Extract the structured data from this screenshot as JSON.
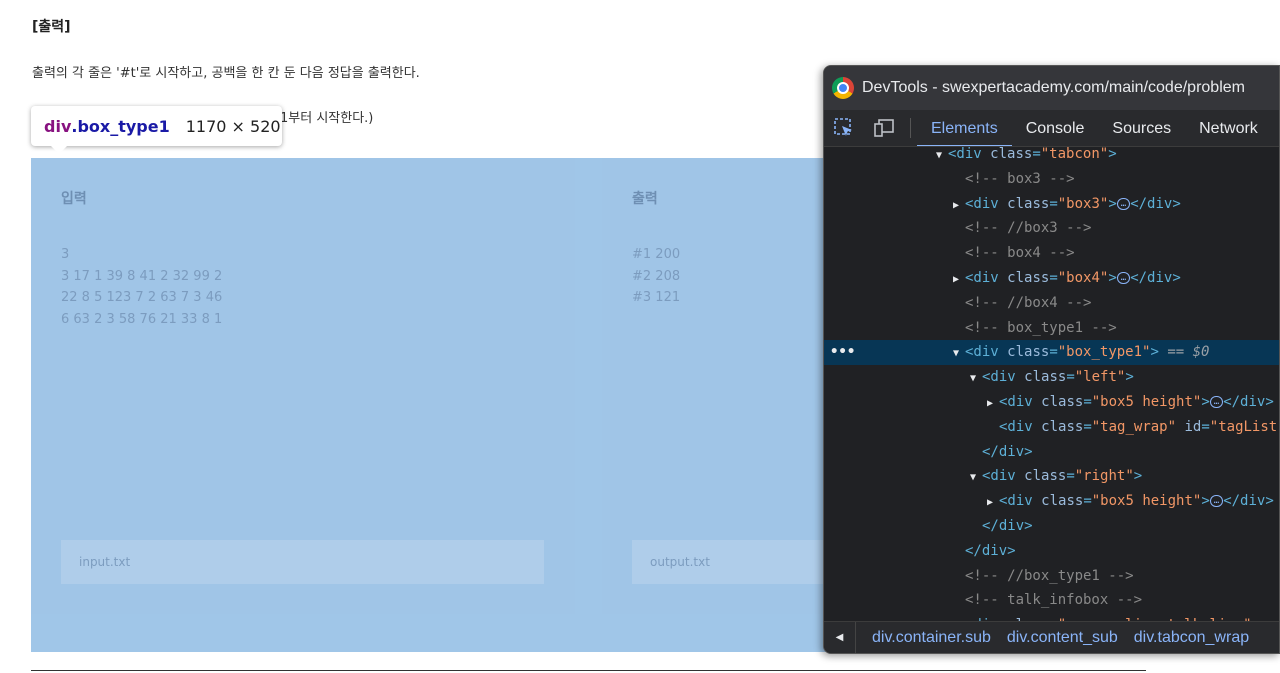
{
  "page": {
    "heading": "[출력]",
    "para1": "출력의 각 줄은 '#t'로 시작하고, 공백을 한 칸 둔 다음 정답을 출력한다.",
    "para2_visible": "1부터 시작한다.)"
  },
  "tooltip": {
    "tag": "div",
    "cls": ".box_type1",
    "size": "1170 × 520"
  },
  "input_panel": {
    "title": "입력",
    "lines": [
      "3",
      "3 17 1 39 8 41 2 32 99 2",
      "22 8 5 123 7 2 63 7 3 46",
      "6 63 2 3 58 76 21 33 8 1"
    ],
    "file": "input.txt"
  },
  "output_panel": {
    "title": "출력",
    "lines": [
      "#1 200",
      "#2 208",
      "#3 121"
    ],
    "file": "output.txt"
  },
  "devtools": {
    "title": "DevTools - swexpertacademy.com/main/code/problem",
    "tabs": [
      "Elements",
      "Console",
      "Sources",
      "Network"
    ],
    "dom": [
      {
        "indent": 1,
        "tri": "▼",
        "html": [
          [
            "tag",
            "<div "
          ],
          [
            "attr",
            "class"
          ],
          [
            "tag",
            "="
          ],
          [
            "val",
            "\"tabcon\""
          ],
          [
            "tag",
            ">"
          ]
        ]
      },
      {
        "indent": 2,
        "tri": "",
        "html": [
          [
            "cmt",
            "<!-- box3 -->"
          ]
        ]
      },
      {
        "indent": 2,
        "tri": "▶",
        "html": [
          [
            "tag",
            "<div "
          ],
          [
            "attr",
            "class"
          ],
          [
            "tag",
            "="
          ],
          [
            "val",
            "\"box3\""
          ],
          [
            "tag",
            ">"
          ],
          [
            "ell",
            "…"
          ],
          [
            "tag",
            "</div>"
          ]
        ]
      },
      {
        "indent": 2,
        "tri": "",
        "html": [
          [
            "cmt",
            "<!-- //box3 -->"
          ]
        ]
      },
      {
        "indent": 2,
        "tri": "",
        "html": [
          [
            "cmt",
            "<!-- box4 -->"
          ]
        ]
      },
      {
        "indent": 2,
        "tri": "▶",
        "html": [
          [
            "tag",
            "<div "
          ],
          [
            "attr",
            "class"
          ],
          [
            "tag",
            "="
          ],
          [
            "val",
            "\"box4\""
          ],
          [
            "tag",
            ">"
          ],
          [
            "ell",
            "…"
          ],
          [
            "tag",
            "</div>"
          ]
        ]
      },
      {
        "indent": 2,
        "tri": "",
        "html": [
          [
            "cmt",
            "<!-- //box4 -->"
          ]
        ]
      },
      {
        "indent": 2,
        "tri": "",
        "html": [
          [
            "cmt",
            "<!-- box_type1 -->"
          ]
        ]
      },
      {
        "indent": 2,
        "tri": "▼",
        "sel": true,
        "html": [
          [
            "tag",
            "<div "
          ],
          [
            "attr",
            "class"
          ],
          [
            "tag",
            "="
          ],
          [
            "val",
            "\"box_type1\""
          ],
          [
            "tag",
            ">"
          ],
          [
            "eq",
            " == $0"
          ]
        ]
      },
      {
        "indent": 3,
        "tri": "▼",
        "html": [
          [
            "tag",
            "<div "
          ],
          [
            "attr",
            "class"
          ],
          [
            "tag",
            "="
          ],
          [
            "val",
            "\"left\""
          ],
          [
            "tag",
            ">"
          ]
        ]
      },
      {
        "indent": 4,
        "tri": "▶",
        "html": [
          [
            "tag",
            "<div "
          ],
          [
            "attr",
            "class"
          ],
          [
            "tag",
            "="
          ],
          [
            "val",
            "\"box5 height\""
          ],
          [
            "tag",
            ">"
          ],
          [
            "ell",
            "…"
          ],
          [
            "tag",
            "</div>"
          ]
        ]
      },
      {
        "indent": 4,
        "tri": "",
        "html": [
          [
            "tag",
            "<div "
          ],
          [
            "attr",
            "class"
          ],
          [
            "tag",
            "="
          ],
          [
            "val",
            "\"tag_wrap\""
          ],
          [
            "tag",
            " "
          ],
          [
            "attr",
            "id"
          ],
          [
            "tag",
            "="
          ],
          [
            "val",
            "\"tagList\""
          ]
        ]
      },
      {
        "indent": 3,
        "tri": "",
        "html": [
          [
            "tag",
            "</div>"
          ]
        ]
      },
      {
        "indent": 3,
        "tri": "▼",
        "html": [
          [
            "tag",
            "<div "
          ],
          [
            "attr",
            "class"
          ],
          [
            "tag",
            "="
          ],
          [
            "val",
            "\"right\""
          ],
          [
            "tag",
            ">"
          ]
        ]
      },
      {
        "indent": 4,
        "tri": "▶",
        "html": [
          [
            "tag",
            "<div "
          ],
          [
            "attr",
            "class"
          ],
          [
            "tag",
            "="
          ],
          [
            "val",
            "\"box5 height\""
          ],
          [
            "tag",
            ">"
          ],
          [
            "ell",
            "…"
          ],
          [
            "tag",
            "</div>"
          ]
        ]
      },
      {
        "indent": 3,
        "tri": "",
        "html": [
          [
            "tag",
            "</div>"
          ]
        ]
      },
      {
        "indent": 2,
        "tri": "",
        "html": [
          [
            "tag",
            "</div>"
          ]
        ]
      },
      {
        "indent": 2,
        "tri": "",
        "html": [
          [
            "cmt",
            "<!-- //box_type1 -->"
          ]
        ]
      },
      {
        "indent": 2,
        "tri": "",
        "html": [
          [
            "cmt",
            "<!-- talk_infobox -->"
          ]
        ]
      },
      {
        "indent": 2,
        "tri": "▶",
        "html": [
          [
            "tag",
            "<div "
          ],
          [
            "attr",
            "class"
          ],
          [
            "tag",
            "="
          ],
          [
            "val",
            "\"source_line talk_line\""
          ],
          [
            "tag",
            ">"
          ]
        ]
      }
    ],
    "breadcrumbs": [
      "div.container.sub",
      "div.content_sub",
      "div.tabcon_wrap"
    ]
  }
}
